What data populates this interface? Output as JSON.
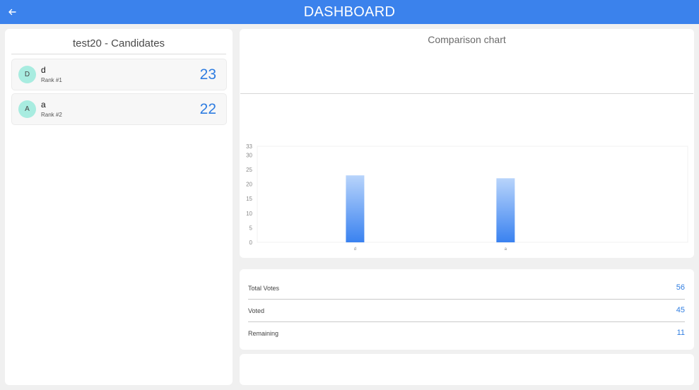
{
  "header": {
    "title": "DASHBOARD",
    "back_icon": "arrow-left-icon",
    "color": "#3b82ec"
  },
  "candidates_panel": {
    "title": "test20 - Candidates",
    "candidates": [
      {
        "initial": "D",
        "name": "d",
        "rank": "Rank #1",
        "votes": "23"
      },
      {
        "initial": "A",
        "name": "a",
        "rank": "Rank #2",
        "votes": "22"
      }
    ]
  },
  "chart_panel": {
    "title": "Comparison chart"
  },
  "chart_data": {
    "type": "bar",
    "categories": [
      "d",
      "a"
    ],
    "values": [
      23,
      22
    ],
    "y_ticks": [
      0,
      5,
      10,
      15,
      20,
      25,
      30,
      33
    ],
    "ylim": [
      0,
      33
    ],
    "bar_gradient": [
      "#b8d4fb",
      "#3a82f0"
    ]
  },
  "stats": {
    "rows": [
      {
        "label": "Total Votes",
        "value": "56"
      },
      {
        "label": "Voted",
        "value": "45"
      },
      {
        "label": "Remaining",
        "value": "11"
      }
    ]
  }
}
